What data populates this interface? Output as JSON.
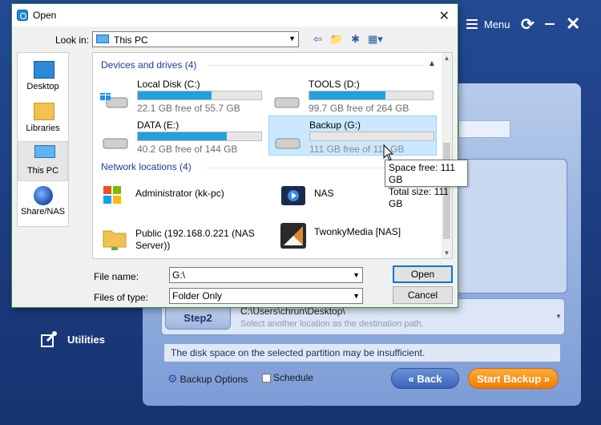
{
  "app": {
    "menu_label": "Menu",
    "utilities_label": "Utilities",
    "step2": {
      "label": "Step2",
      "path": "C:\\Users\\chrun\\Desktop\\",
      "hint": "Select another location as the destination path."
    },
    "warning": "The disk space on the selected partition may be insufficient.",
    "backup_options_label": "Backup Options",
    "schedule_label": "Schedule",
    "back_label": "« Back",
    "start_label": "Start Backup »"
  },
  "dialog": {
    "title": "Open",
    "look_in_label": "Look in:",
    "look_in_value": "This PC",
    "places": [
      {
        "label": "Desktop"
      },
      {
        "label": "Libraries"
      },
      {
        "label": "This PC"
      },
      {
        "label": "Share/NAS"
      }
    ],
    "groups": {
      "devices": "Devices and drives (4)",
      "network": "Network locations (4)"
    },
    "drives": [
      {
        "name": "Local Disk (C:)",
        "free": "22.1 GB free of 55.7 GB",
        "used_fraction": 0.6
      },
      {
        "name": "TOOLS (D:)",
        "free": "99.7 GB free of 264 GB",
        "used_fraction": 0.62
      },
      {
        "name": "DATA (E:)",
        "free": "40.2 GB free of 144 GB",
        "used_fraction": 0.72
      },
      {
        "name": "Backup (G:)",
        "free": "111 GB free of 111 GB",
        "used_fraction": 0.0
      }
    ],
    "network": [
      {
        "name": "Administrator (kk-pc)",
        "icon": "windows-media-player-icon"
      },
      {
        "name": "NAS",
        "icon": "media-server-icon"
      },
      {
        "name": "Public (192.168.0.221 (NAS Server))",
        "line1": "Public (192.168.0.221 (NAS",
        "line2": "Server))",
        "icon": "network-folder-icon"
      },
      {
        "name": "TwonkyMedia [NAS]",
        "icon": "twonky-media-icon"
      }
    ],
    "tooltip": {
      "line1": "Space free: 111 GB",
      "line2": "Total size: 111 GB"
    },
    "file_name_label": "File name:",
    "file_name_value": "G:\\",
    "file_type_label": "Files of type:",
    "file_type_value": "Folder Only",
    "open_label": "Open",
    "cancel_label": "Cancel"
  },
  "colors": {
    "accent": "#0078d7",
    "drive_bar": "#26a0da",
    "start_button": "#f08a00",
    "app_bg": "#1d3c80"
  }
}
